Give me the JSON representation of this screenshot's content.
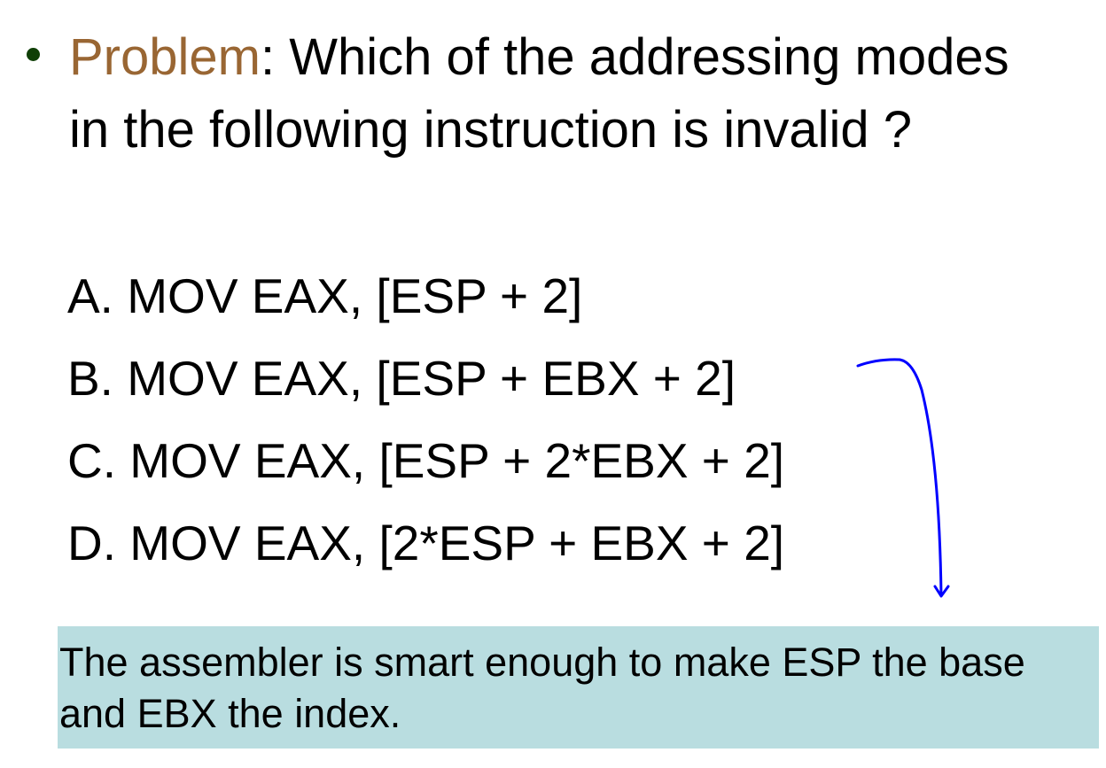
{
  "slide": {
    "bullet_color": "#0f3f06",
    "question": {
      "label": "Problem",
      "label_color": "#996633",
      "line1_rest": ": Which of the addressing modes",
      "line2": "in the following instruction is invalid ?"
    },
    "options": [
      "A. MOV EAX, [ESP + 2]",
      "B. MOV EAX, [ESP + EBX + 2]",
      "C. MOV EAX, [ESP + 2*EBX + 2]",
      "D. MOV EAX, [2*ESP + EBX + 2]"
    ],
    "annotation_arrow_color": "#0000ff",
    "note": {
      "text": "The assembler is smart enough to make ESP the base and EBX the index.",
      "background": "#b9dde0"
    }
  }
}
